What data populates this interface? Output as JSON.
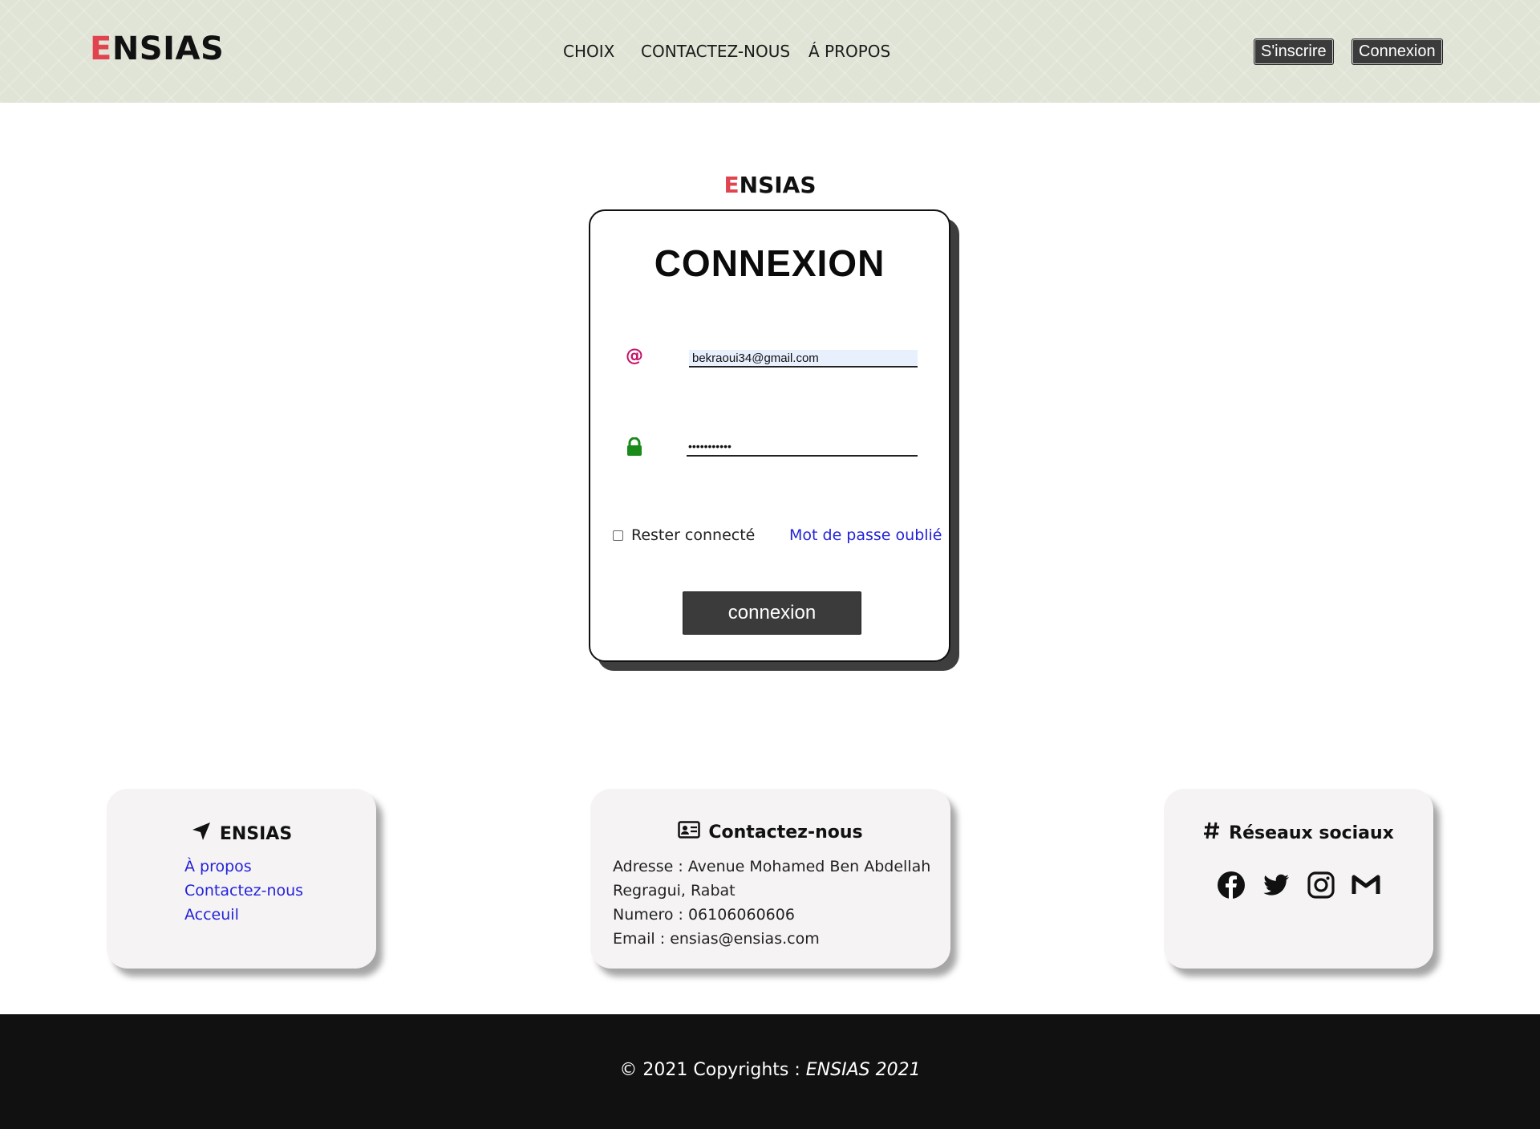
{
  "brand": {
    "first_letter": "E",
    "rest": "NSIAS",
    "accent_color": "#e0444e"
  },
  "nav": {
    "items": [
      {
        "label": "CHOIX"
      },
      {
        "label": "CONTACTEZ-NOUS"
      },
      {
        "label": "Á PROPOS"
      }
    ]
  },
  "header_buttons": {
    "signup": "S'inscrire",
    "login": "Connexion"
  },
  "login": {
    "title": "CONNEXION",
    "email_icon": "@",
    "email_value": "bekraoui34@gmail.com",
    "password_value": "•••••••••••",
    "remember_label": "Rester connecté",
    "forgot_label": "Mot de passe oublié",
    "submit_label": "connexion"
  },
  "footer_cards": {
    "about": {
      "title": "ENSIAS",
      "icon": "location-arrow-icon",
      "links": [
        "À propos",
        "Contactez-nous",
        "Acceuil"
      ]
    },
    "contact": {
      "title": "Contactez-nous",
      "icon": "id-card-icon",
      "lines": [
        "Adresse : Avenue Mohamed Ben Abdellah",
        "Regragui, Rabat",
        "Numero : 06106060606",
        "Email : ensias@ensias.com"
      ]
    },
    "social": {
      "title": "Réseaux sociaux",
      "icon": "hashtag-icon",
      "networks": [
        "facebook-icon",
        "twitter-icon",
        "instagram-icon",
        "gmail-icon"
      ]
    }
  },
  "copyright": {
    "prefix": "© 2021 Copyrights : ",
    "owner": "ENSIAS 2021"
  }
}
